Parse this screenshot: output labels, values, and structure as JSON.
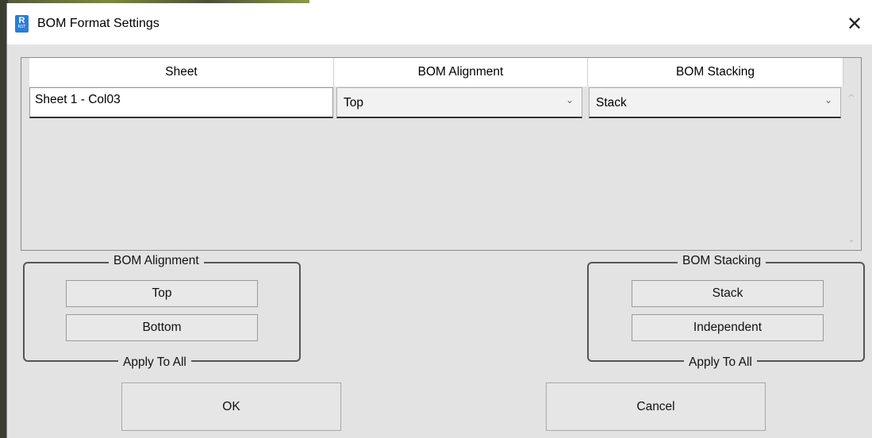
{
  "window": {
    "title": "BOM Format Settings",
    "app_icon": {
      "letter": "R",
      "sub": "RST",
      "color": "#2a7dd8"
    },
    "close_glyph": "✕"
  },
  "grid": {
    "columns": [
      "Sheet",
      "BOM Alignment",
      "BOM Stacking"
    ],
    "rows": [
      {
        "sheet": "Sheet 1 - Col03",
        "alignment": "Top",
        "stacking": "Stack"
      }
    ],
    "combo_arrow": "⌄",
    "scroll_up": "^",
    "scroll_down": "⌄"
  },
  "alignment_group": {
    "title": "BOM Alignment",
    "buttons": [
      "Top",
      "Bottom"
    ],
    "footer": "Apply To All"
  },
  "stacking_group": {
    "title": "BOM Stacking",
    "buttons": [
      "Stack",
      "Independent"
    ],
    "footer": "Apply To All"
  },
  "actions": {
    "ok": "OK",
    "cancel": "Cancel"
  }
}
